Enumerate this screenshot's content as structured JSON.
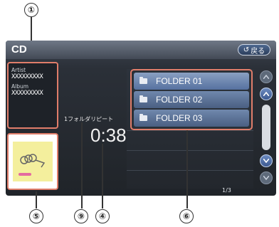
{
  "callouts": {
    "c1": "①",
    "c5": "⑤",
    "c9": "⑨",
    "c4": "④",
    "c6": "⑥"
  },
  "screen": {
    "title": "CD",
    "back_label": "戻る",
    "artist_label": "Artist",
    "artist_value": "XXXXXXXXX",
    "album_label": "Album",
    "album_value": "XXXXXXXXX",
    "repeat_mode": "1フォルダリピート",
    "elapsed_time": "0:38",
    "folders": [
      "FOLDER 01",
      "FOLDER 02",
      "FOLDER 03"
    ],
    "page_indicator": "1/3"
  },
  "colors": {
    "highlight_frame": "#e07d6a",
    "folder_row": "#5671a0",
    "screen_bg": "#202429"
  },
  "icons": [
    "back-arrow-icon",
    "folder-icon",
    "scroll-up-icon",
    "scroll-down-icon",
    "album-art-thumbnail"
  ]
}
